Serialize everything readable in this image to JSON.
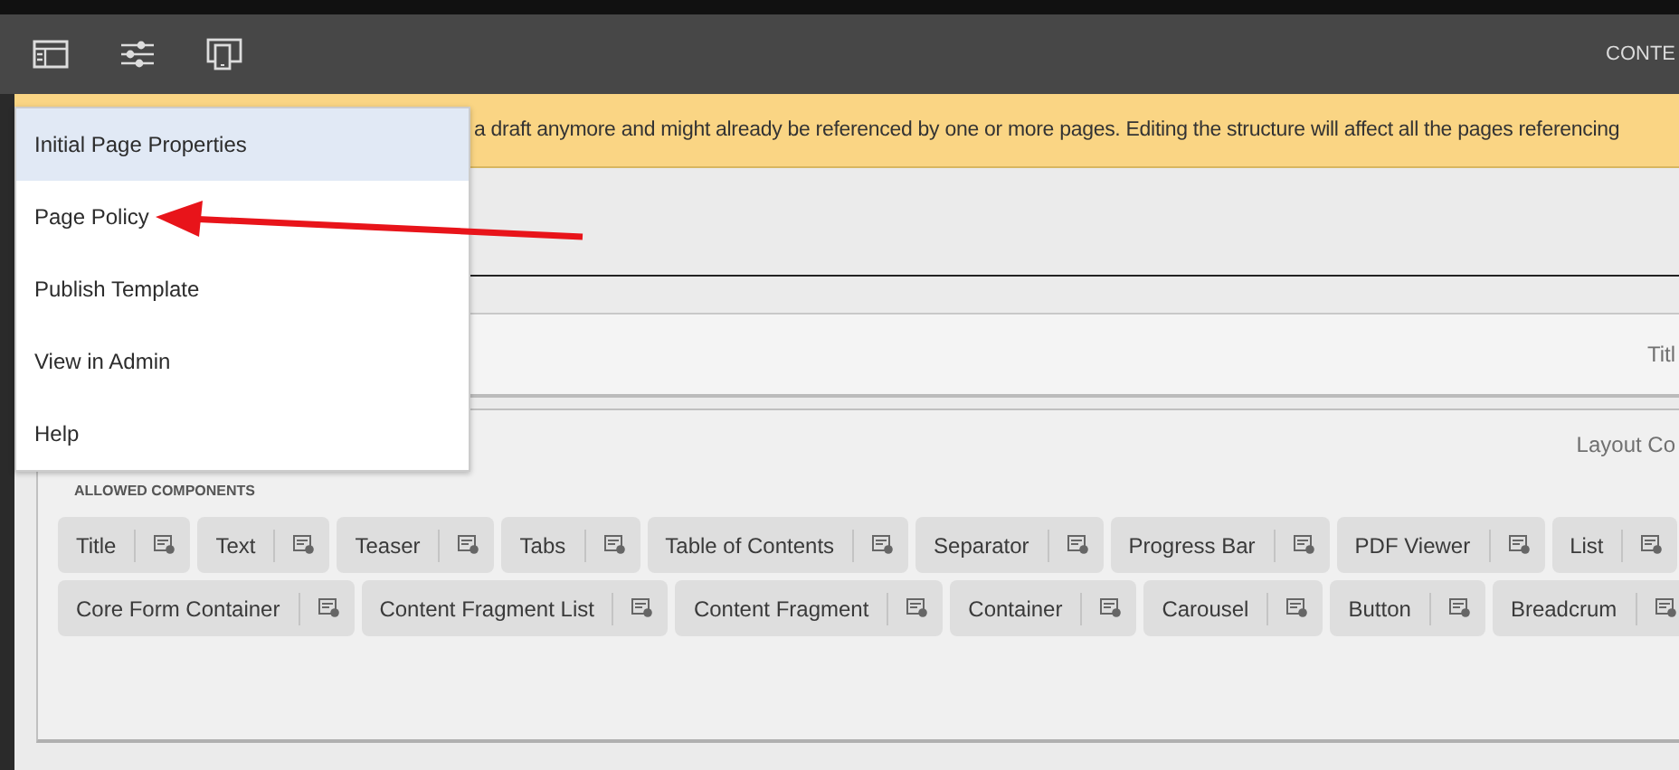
{
  "toolbar": {
    "right_label": "CONTE"
  },
  "banner": {
    "text": "a draft anymore and might already be referenced by one or more pages. Editing the structure will affect all the pages referencing"
  },
  "menu": {
    "items": [
      {
        "label": "Initial Page Properties",
        "selected": true
      },
      {
        "label": "Page Policy",
        "selected": false
      },
      {
        "label": "Publish Template",
        "selected": false
      },
      {
        "label": "View in Admin",
        "selected": false
      },
      {
        "label": "Help",
        "selected": false
      }
    ]
  },
  "title_component": {
    "label": "Titl"
  },
  "layout_container": {
    "label": "Layout Co",
    "allowed_heading": "ALLOWED COMPONENTS",
    "chip_rows": [
      {
        "chips": [
          {
            "label": "Title"
          },
          {
            "label": "Text"
          },
          {
            "label": "Teaser"
          },
          {
            "label": "Tabs"
          },
          {
            "label": "Table of Contents"
          },
          {
            "label": "Separator"
          },
          {
            "label": "Progress Bar"
          },
          {
            "label": "PDF Viewer"
          },
          {
            "label": "List"
          }
        ]
      },
      {
        "chips": [
          {
            "label": "Core Form Container"
          },
          {
            "label": "Content Fragment List"
          },
          {
            "label": "Content Fragment"
          },
          {
            "label": "Container"
          },
          {
            "label": "Carousel"
          },
          {
            "label": "Button"
          },
          {
            "label": "Breadcrum"
          }
        ]
      }
    ]
  }
}
